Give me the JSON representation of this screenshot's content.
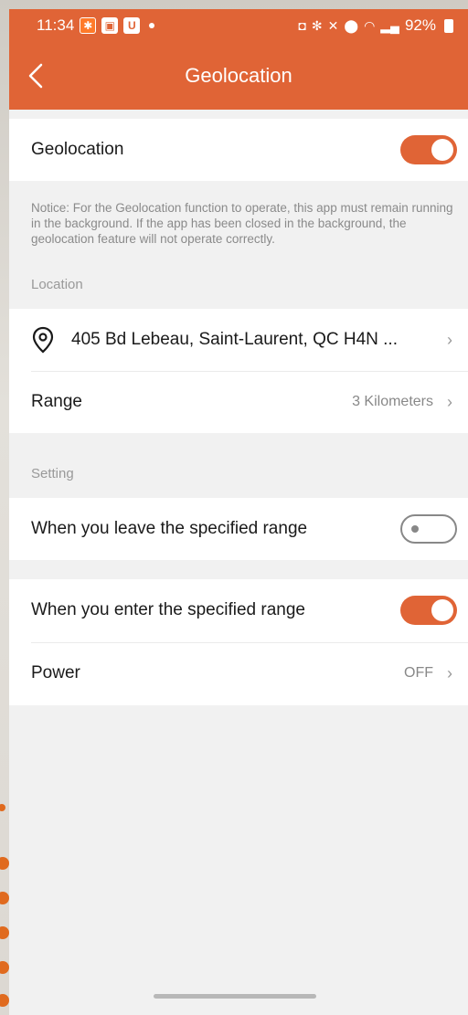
{
  "status_bar": {
    "time": "11:34",
    "battery": "92%",
    "icons": [
      "app-notification-icon",
      "gallery-icon",
      "app-u-icon",
      "dot-icon",
      "bluetooth-icon",
      "mute-icon",
      "location-icon",
      "wifi-icon",
      "signal-icon",
      "battery-icon"
    ]
  },
  "header": {
    "title": "Geolocation",
    "back_icon": "chevron-left-icon"
  },
  "geolocation": {
    "label": "Geolocation",
    "enabled": true,
    "notice": "Notice: For the Geolocation function to operate, this app must remain running in the background. If the app has been closed in the background, the geolocation feature will not operate correctly."
  },
  "location_section": {
    "title": "Location",
    "address": "405 Bd Lebeau, Saint-Laurent, QC H4N ...",
    "range_label": "Range",
    "range_value": "3 Kilometers"
  },
  "setting_section": {
    "title": "Setting",
    "leave_label": "When you leave the specified range",
    "leave_enabled": false,
    "enter_label": "When you enter the specified range",
    "enter_enabled": true,
    "power_label": "Power",
    "power_value": "OFF"
  },
  "colors": {
    "accent": "#e06436",
    "background": "#f1f1f1",
    "card": "#ffffff"
  }
}
